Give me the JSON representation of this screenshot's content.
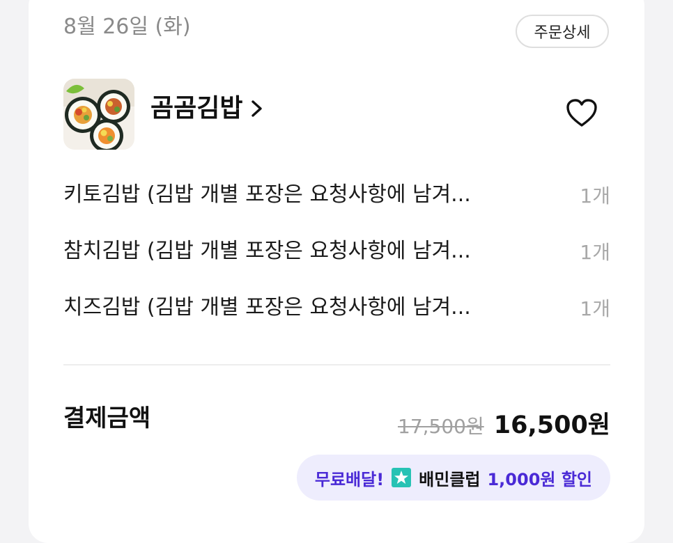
{
  "order": {
    "date": "8월 26일 (화)",
    "detail_button": "주문상세"
  },
  "store": {
    "name": "곰곰김밥",
    "thumbnail": "gimbap-photo",
    "chevron_icon": "chevron-right-icon",
    "favorite_icon": "heart-outline-icon"
  },
  "items": [
    {
      "name": "키토김밥 (김밥 개별 포장은 요청사항에 남겨...",
      "qty": "1개"
    },
    {
      "name": "참치김밥 (김밥 개별 포장은 요청사항에 남겨...",
      "qty": "1개"
    },
    {
      "name": "치즈김밥 (김밥 개별 포장은 요청사항에 남겨...",
      "qty": "1개"
    }
  ],
  "payment": {
    "label": "결제금액",
    "original_price": "17,500원",
    "final_price": "16,500원"
  },
  "promo": {
    "free_delivery": "무료배달!",
    "star_icon": "baemin-club-star-icon",
    "club_name": "배민클럽",
    "discount": "1,000원 할인"
  },
  "colors": {
    "accent_purple": "#4a2ad6",
    "badge_bg": "#eeedfd",
    "club_teal": "#27c2b4"
  }
}
